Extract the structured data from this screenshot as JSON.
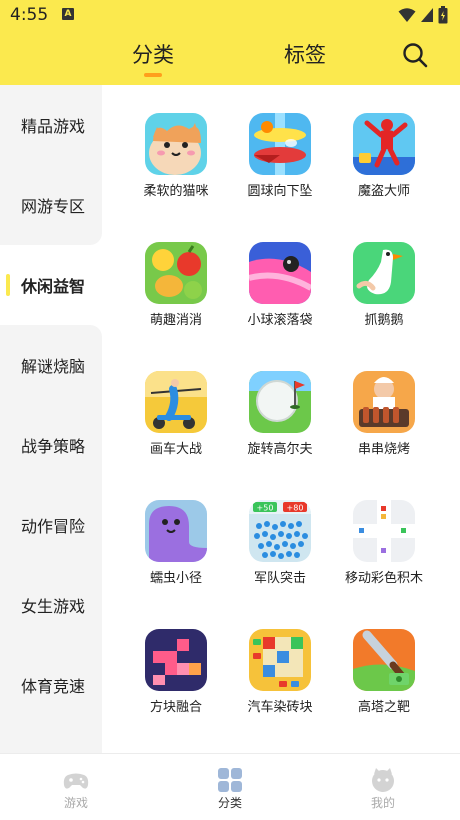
{
  "status_bar": {
    "time": "4:55",
    "a_icon": "A"
  },
  "header": {
    "tabs": [
      {
        "label": "分类",
        "active": true
      },
      {
        "label": "标签",
        "active": false
      }
    ],
    "accent": "#fbe94e",
    "underline_color": "#ff9f1c"
  },
  "sidebar": {
    "items": [
      {
        "label": "精品游戏"
      },
      {
        "label": "网游专区"
      },
      {
        "label": "休闲益智",
        "active": true
      },
      {
        "label": "解谜烧脑"
      },
      {
        "label": "战争策略"
      },
      {
        "label": "动作冒险"
      },
      {
        "label": "女生游戏"
      },
      {
        "label": "体育竞速"
      }
    ]
  },
  "games": [
    {
      "name": "柔软的猫咪",
      "icon": "cat-icon"
    },
    {
      "name": "圆球向下坠",
      "icon": "helix-ball-icon"
    },
    {
      "name": "魔盗大师",
      "icon": "red-thief-icon"
    },
    {
      "name": "萌趣消消",
      "icon": "fruit-match-icon"
    },
    {
      "name": "小球滚落袋",
      "icon": "ball-pocket-icon"
    },
    {
      "name": "抓鹅鹅",
      "icon": "goose-icon"
    },
    {
      "name": "画车大战",
      "icon": "draw-car-icon"
    },
    {
      "name": "旋转高尔夫",
      "icon": "golf-icon"
    },
    {
      "name": "串串烧烤",
      "icon": "bbq-icon"
    },
    {
      "name": "蠕虫小径",
      "icon": "worm-icon"
    },
    {
      "name": "军队突击",
      "icon": "army-icon"
    },
    {
      "name": "移动彩色积木",
      "icon": "color-blocks-icon"
    },
    {
      "name": "方块融合",
      "icon": "block-merge-icon"
    },
    {
      "name": "汽车染砖块",
      "icon": "car-bricks-icon"
    },
    {
      "name": "高塔之靶",
      "icon": "knife-target-icon"
    }
  ],
  "army_labels": [
    "+50",
    "+80"
  ],
  "bottom_nav": [
    {
      "label": "游戏",
      "icon": "gamepad-icon"
    },
    {
      "label": "分类",
      "icon": "grid-icon",
      "active": true
    },
    {
      "label": "我的",
      "icon": "face-icon"
    }
  ]
}
